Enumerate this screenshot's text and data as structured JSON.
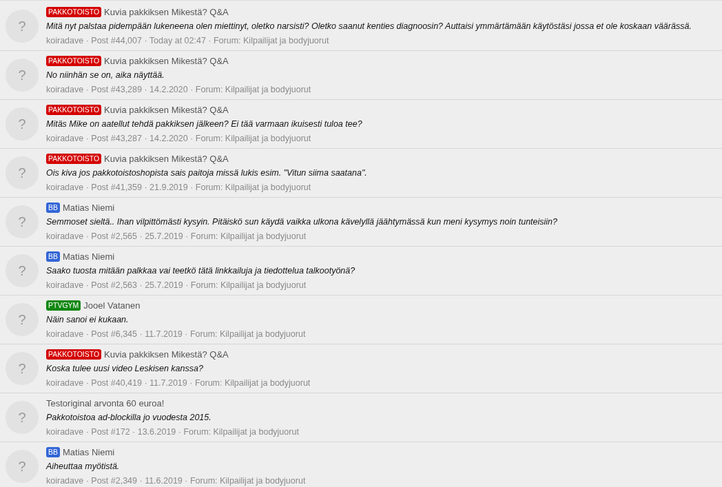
{
  "results": [
    {
      "avatar": "?",
      "prefix": {
        "label": "PAKKOTOISTO",
        "color": "#d40000"
      },
      "title": "Kuvia pakkiksen Mikestä? Q&A",
      "snippet": "Mitä nyt palstaa pidempään lukeneena olen miettinyt, oletko narsisti? Oletko saanut kenties diagnoosin? Auttaisi ymmärtämään käytöstäsi jossa et ole koskaan väärässä.",
      "meta": "koiradave · Post #44,007 · Today at 02:47 · Forum: Kilpailijat ja bodyjuorut"
    },
    {
      "avatar": "?",
      "prefix": {
        "label": "PAKKOTOISTO",
        "color": "#d40000"
      },
      "title": "Kuvia pakkiksen Mikestä? Q&A",
      "snippet": "No niinhän se on, aika näyttää.",
      "meta": "koiradave · Post #43,289 · 14.2.2020 · Forum: Kilpailijat ja bodyjuorut"
    },
    {
      "avatar": "?",
      "prefix": {
        "label": "PAKKOTOISTO",
        "color": "#d40000"
      },
      "title": "Kuvia pakkiksen Mikestä? Q&A",
      "snippet": "Mitäs Mike on aatellut tehdä pakkiksen jälkeen? Ei tää varmaan ikuisesti tuloa tee?",
      "meta": "koiradave · Post #43,287 · 14.2.2020 · Forum: Kilpailijat ja bodyjuorut"
    },
    {
      "avatar": "?",
      "prefix": {
        "label": "PAKKOTOISTO",
        "color": "#d40000"
      },
      "title": "Kuvia pakkiksen Mikestä? Q&A",
      "snippet": "Ois kiva jos pakkotoistoshopista sais paitoja missä lukis esim. \"Vitun siima saatana\".",
      "meta": "koiradave · Post #41,359 · 21.9.2019 · Forum: Kilpailijat ja bodyjuorut"
    },
    {
      "avatar": "?",
      "prefix": {
        "label": "BB",
        "color": "#3366d6"
      },
      "title": "Matias Niemi",
      "snippet": "Semmoset sieltä.. Ihan vilpittömästi kysyin. Pitäiskö sun käydä vaikka ulkona kävelyllä jäähtymässä kun meni kysymys noin tunteisiin?",
      "meta": "koiradave · Post #2,565 · 25.7.2019 · Forum: Kilpailijat ja bodyjuorut"
    },
    {
      "avatar": "?",
      "prefix": {
        "label": "BB",
        "color": "#3366d6"
      },
      "title": "Matias Niemi",
      "snippet": "Saako tuosta mitään palkkaa vai teetkö tätä linkkailuja ja tiedottelua talkootyönä?",
      "meta": "koiradave · Post #2,563 · 25.7.2019 · Forum: Kilpailijat ja bodyjuorut"
    },
    {
      "avatar": "?",
      "prefix": {
        "label": "PTVGYM",
        "color": "#118811"
      },
      "title": "Jooel Vatanen",
      "snippet": "Näin sanoi ei kukaan.",
      "meta": "koiradave · Post #6,345 · 11.7.2019 · Forum: Kilpailijat ja bodyjuorut"
    },
    {
      "avatar": "?",
      "prefix": {
        "label": "PAKKOTOISTO",
        "color": "#d40000"
      },
      "title": "Kuvia pakkiksen Mikestä? Q&A",
      "snippet": "Koska tulee uusi video Leskisen kanssa?",
      "meta": "koiradave · Post #40,419 · 11.7.2019 · Forum: Kilpailijat ja bodyjuorut"
    },
    {
      "avatar": "?",
      "title": "Testoriginal arvonta 60 euroa!",
      "snippet": "Pakkotoistoa ad-blockilla jo vuodesta 2015.",
      "meta": "koiradave · Post #172 · 13.6.2019 · Forum: Kilpailijat ja bodyjuorut"
    },
    {
      "avatar": "?",
      "prefix": {
        "label": "BB",
        "color": "#3366d6"
      },
      "title": "Matias Niemi",
      "snippet": "Aiheuttaa myötistä.",
      "meta": "koiradave · Post #2,349 · 11.6.2019 · Forum: Kilpailijat ja bodyjuorut"
    }
  ]
}
